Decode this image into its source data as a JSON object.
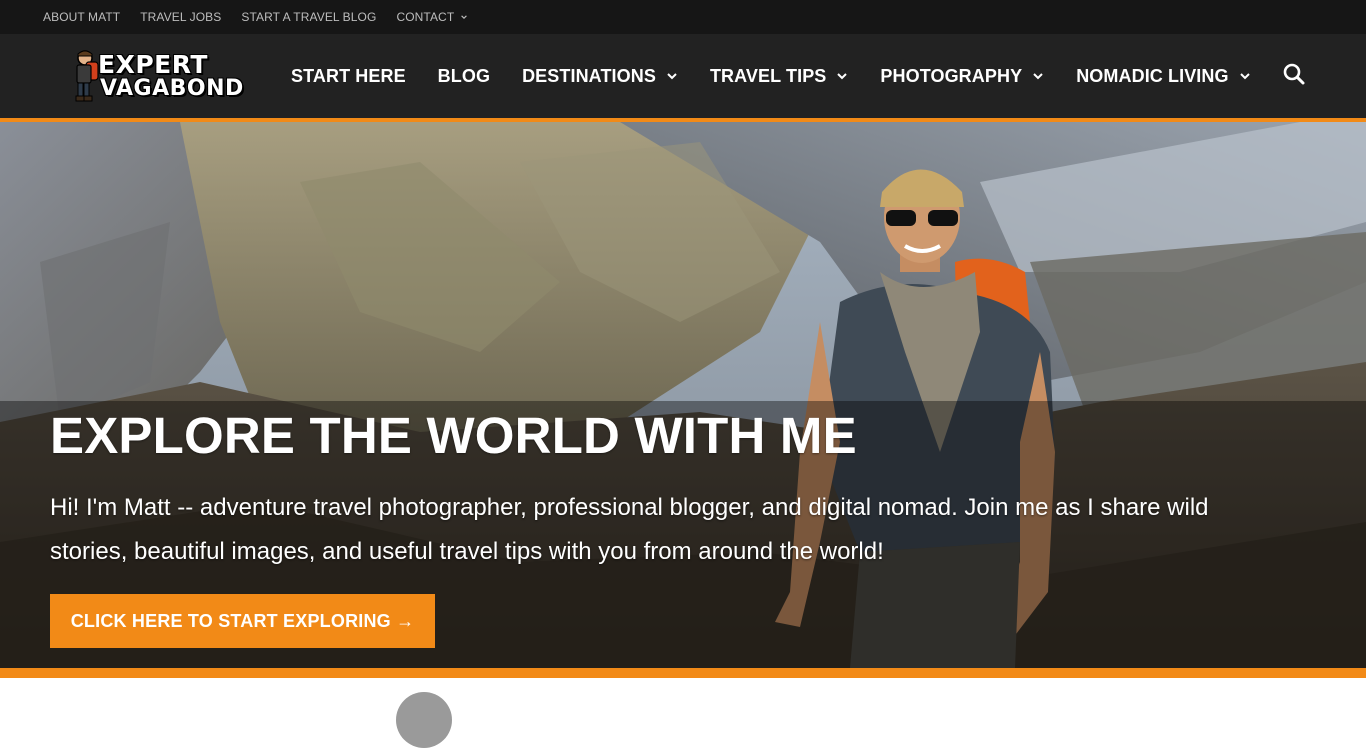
{
  "topbar": {
    "links": [
      "ABOUT MATT",
      "TRAVEL JOBS",
      "START A TRAVEL BLOG",
      "CONTACT"
    ]
  },
  "logo": {
    "line1": "EXPERT",
    "line2": "VAGABOND"
  },
  "nav": {
    "items": [
      {
        "label": "START HERE",
        "dropdown": false
      },
      {
        "label": "BLOG",
        "dropdown": false
      },
      {
        "label": "DESTINATIONS",
        "dropdown": true
      },
      {
        "label": "TRAVEL TIPS",
        "dropdown": true
      },
      {
        "label": "PHOTOGRAPHY",
        "dropdown": true
      },
      {
        "label": "NOMADIC LIVING",
        "dropdown": true
      }
    ],
    "search_icon": "search-icon"
  },
  "hero": {
    "title": "EXPLORE THE WORLD WITH ME",
    "subtitle": "Hi! I'm Matt -- adventure travel photographer, professional blogger, and digital nomad. Join me as I share wild stories, beautiful images, and useful travel tips with you from around the world!",
    "cta_label": "CLICK HERE TO START EXPLORING →"
  },
  "colors": {
    "accent": "#f28a17",
    "topbar_bg": "#161616",
    "nav_bg": "#222222"
  }
}
